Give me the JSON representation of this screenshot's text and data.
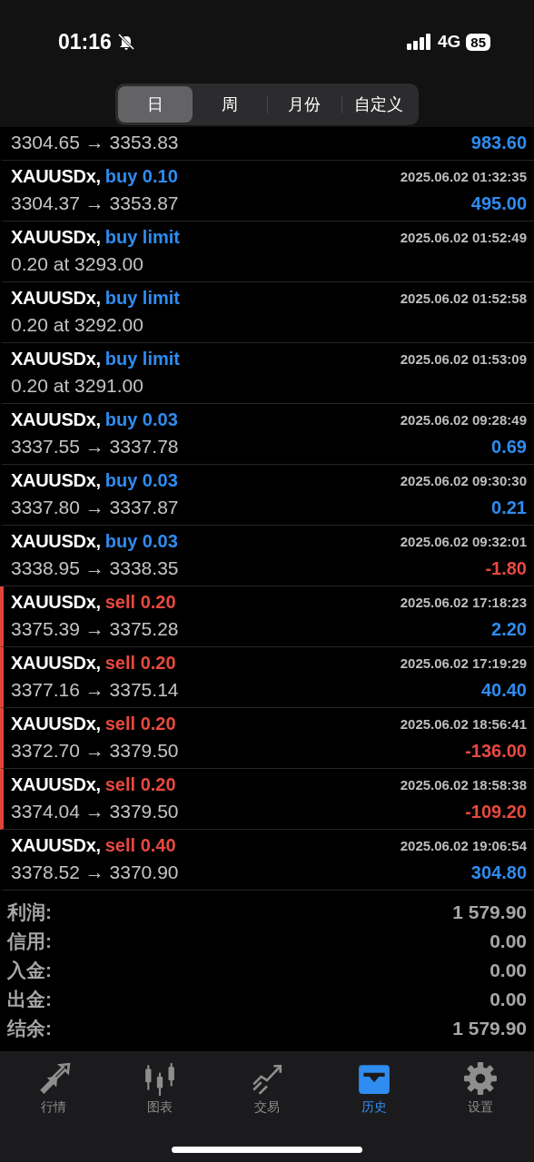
{
  "status_bar": {
    "time": "01:16",
    "silent": true,
    "network": "4G",
    "battery": "85"
  },
  "period_tabs": [
    {
      "label": "日",
      "selected": true
    },
    {
      "label": "周",
      "selected": false
    },
    {
      "label": "月份",
      "selected": false
    },
    {
      "label": "自定义",
      "selected": false
    }
  ],
  "deals": [
    {
      "detail": "3304.65 → 3353.83",
      "profit": "983.60",
      "loss": false,
      "marked": false
    },
    {
      "symbol": "XAUUSDx,",
      "side": "buy",
      "volume": "0.10",
      "time": "2025.06.02 01:32:35",
      "detail": "3304.37 → 3353.87",
      "profit": "495.00",
      "loss": false,
      "marked": false
    },
    {
      "symbol": "XAUUSDx,",
      "side": "buy",
      "volume": "limit",
      "time": "2025.06.02 01:52:49",
      "detail": "0.20 at 3293.00",
      "marked": false
    },
    {
      "symbol": "XAUUSDx,",
      "side": "buy",
      "volume": "limit",
      "time": "2025.06.02 01:52:58",
      "detail": "0.20 at 3292.00",
      "marked": false
    },
    {
      "symbol": "XAUUSDx,",
      "side": "buy",
      "volume": "limit",
      "time": "2025.06.02 01:53:09",
      "detail": "0.20 at 3291.00",
      "marked": false
    },
    {
      "symbol": "XAUUSDx,",
      "side": "buy",
      "volume": "0.03",
      "time": "2025.06.02 09:28:49",
      "detail": "3337.55 → 3337.78",
      "profit": "0.69",
      "loss": false,
      "marked": false
    },
    {
      "symbol": "XAUUSDx,",
      "side": "buy",
      "volume": "0.03",
      "time": "2025.06.02 09:30:30",
      "detail": "3337.80 → 3337.87",
      "profit": "0.21",
      "loss": false,
      "marked": false
    },
    {
      "symbol": "XAUUSDx,",
      "side": "buy",
      "volume": "0.03",
      "time": "2025.06.02 09:32:01",
      "detail": "3338.95 → 3338.35",
      "profit": "-1.80",
      "loss": true,
      "marked": false
    },
    {
      "symbol": "XAUUSDx,",
      "side": "sell",
      "volume": "0.20",
      "time": "2025.06.02 17:18:23",
      "detail": "3375.39 → 3375.28",
      "profit": "2.20",
      "loss": false,
      "marked": true
    },
    {
      "symbol": "XAUUSDx,",
      "side": "sell",
      "volume": "0.20",
      "time": "2025.06.02 17:19:29",
      "detail": "3377.16 → 3375.14",
      "profit": "40.40",
      "loss": false,
      "marked": true
    },
    {
      "symbol": "XAUUSDx,",
      "side": "sell",
      "volume": "0.20",
      "time": "2025.06.02 18:56:41",
      "detail": "3372.70 → 3379.50",
      "profit": "-136.00",
      "loss": true,
      "marked": true
    },
    {
      "symbol": "XAUUSDx,",
      "side": "sell",
      "volume": "0.20",
      "time": "2025.06.02 18:58:38",
      "detail": "3374.04 → 3379.50",
      "profit": "-109.20",
      "loss": true,
      "marked": true
    },
    {
      "symbol": "XAUUSDx,",
      "side": "sell",
      "volume": "0.40",
      "time": "2025.06.02 19:06:54",
      "detail": "3378.52 → 3370.90",
      "profit": "304.80",
      "loss": false,
      "marked": false
    }
  ],
  "summary": [
    {
      "label": "利润:",
      "value": "1 579.90"
    },
    {
      "label": "信用:",
      "value": "0.00"
    },
    {
      "label": "入金:",
      "value": "0.00"
    },
    {
      "label": "出金:",
      "value": "0.00"
    },
    {
      "label": "结余:",
      "value": "1 579.90"
    }
  ],
  "tab_bar": [
    {
      "label": "行情",
      "kind": "quotes",
      "selected": false
    },
    {
      "label": "图表",
      "kind": "chart",
      "selected": false
    },
    {
      "label": "交易",
      "kind": "trade",
      "selected": false
    },
    {
      "label": "历史",
      "kind": "history",
      "selected": true
    },
    {
      "label": "设置",
      "kind": "settings",
      "selected": false
    }
  ]
}
